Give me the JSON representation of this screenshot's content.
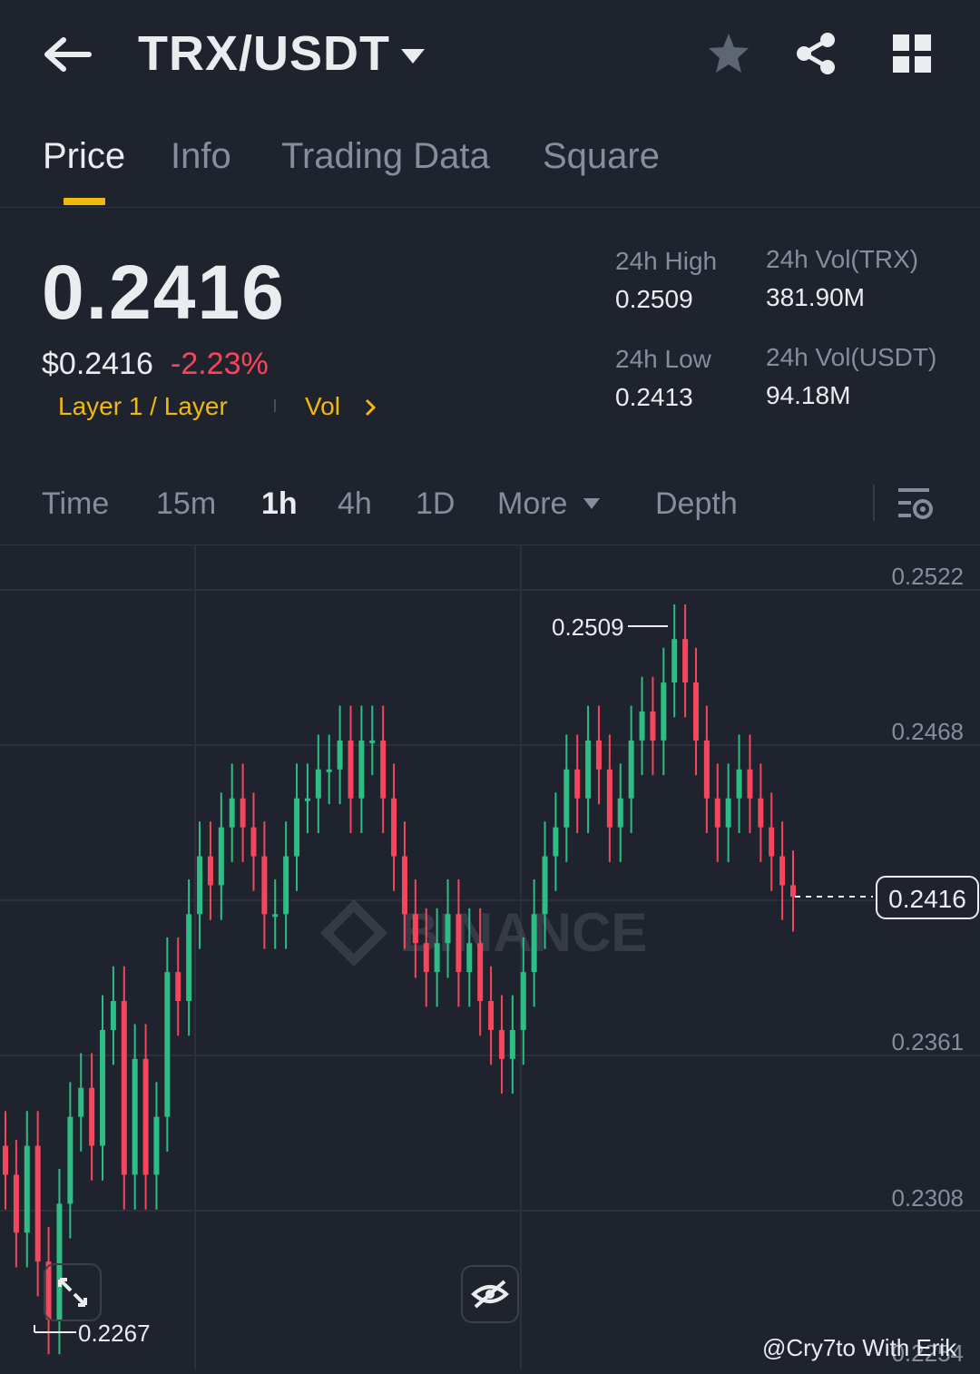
{
  "header": {
    "pair": "TRX/USDT",
    "icons": [
      "arrow-left-icon",
      "caret-down-icon",
      "star-icon",
      "share-icon",
      "grid-icon"
    ]
  },
  "tabs": [
    {
      "label": "Price",
      "active": true
    },
    {
      "label": "Info",
      "active": false
    },
    {
      "label": "Trading Data",
      "active": false
    },
    {
      "label": "Square",
      "active": false
    }
  ],
  "summary": {
    "last_price": "0.2416",
    "usd_price": "$0.2416",
    "change_pct": "-2.23%",
    "tag_category": "Layer 1 / Layer",
    "tag_vol": "Vol",
    "high_label": "24h High",
    "high_value": "0.2509",
    "low_label": "24h Low",
    "low_value": "0.2413",
    "vol_base_label": "24h Vol(TRX)",
    "vol_base_value": "381.90M",
    "vol_quote_label": "24h Vol(USDT)",
    "vol_quote_value": "94.18M"
  },
  "intervals": {
    "items": [
      {
        "label": "Time",
        "active": false
      },
      {
        "label": "15m",
        "active": false
      },
      {
        "label": "1h",
        "active": true
      },
      {
        "label": "4h",
        "active": false
      },
      {
        "label": "1D",
        "active": false
      },
      {
        "label": "More",
        "active": false
      },
      {
        "label": "Depth",
        "active": false
      }
    ]
  },
  "colors": {
    "background": "#1f232d",
    "up": "#2ebd85",
    "down": "#f6465d",
    "accent": "#f0b90b",
    "muted": "#848e9c"
  },
  "chart_data": {
    "type": "candlestick",
    "interval": "1h",
    "y_ticks": [
      "0.2522",
      "0.2468",
      "0.2416",
      "0.2361",
      "0.2308",
      "0.2254"
    ],
    "ylim": [
      0.2254,
      0.2522
    ],
    "high_marker": "0.2509",
    "low_marker": "0.2267",
    "last_price_tag": "0.2416",
    "watermark": "BINANCE",
    "close_path": [
      0.232,
      0.23,
      0.233,
      0.229,
      0.227,
      0.231,
      0.234,
      0.235,
      0.233,
      0.237,
      0.238,
      0.232,
      0.236,
      0.232,
      0.234,
      0.239,
      0.238,
      0.241,
      0.243,
      0.242,
      0.244,
      0.245,
      0.244,
      0.243,
      0.241,
      0.241,
      0.243,
      0.245,
      0.245,
      0.246,
      0.246,
      0.247,
      0.245,
      0.247,
      0.247,
      0.245,
      0.243,
      0.241,
      0.24,
      0.239,
      0.24,
      0.241,
      0.239,
      0.24,
      0.238,
      0.237,
      0.236,
      0.237,
      0.239,
      0.241,
      0.243,
      0.244,
      0.246,
      0.245,
      0.247,
      0.246,
      0.244,
      0.245,
      0.247,
      0.248,
      0.247,
      0.249,
      0.2505,
      0.249,
      0.247,
      0.245,
      0.244,
      0.245,
      0.246,
      0.245,
      0.244,
      0.243,
      0.242,
      0.2416
    ],
    "x_points": 74
  },
  "footer": {
    "watermark_text": "@Cry7to With Erik"
  }
}
